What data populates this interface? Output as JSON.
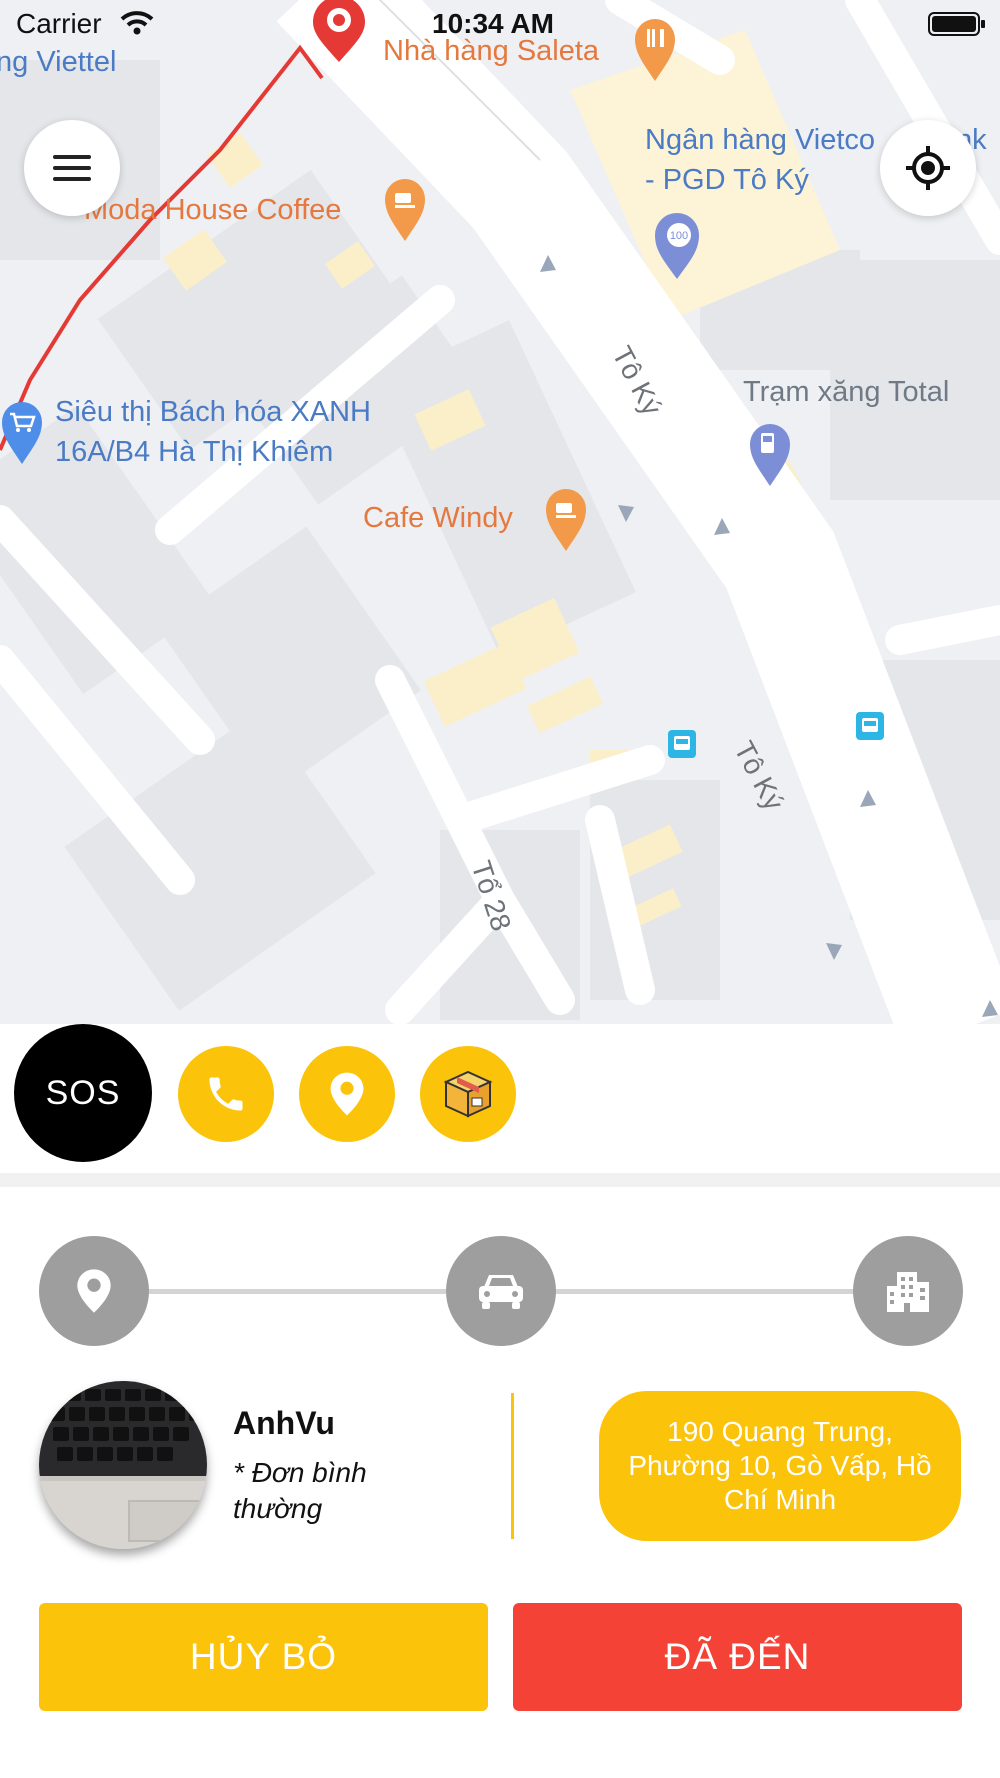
{
  "status_bar": {
    "carrier": "Carrier",
    "time": "10:34 AM"
  },
  "map": {
    "places": {
      "viettel": "ng Viettel",
      "saleta": "Nhà hàng Saleta",
      "vietcombank_line1": "Ngân hàng Vietco",
      "vietcombank_line1_end": "nk",
      "vietcombank_line2": "- PGD Tô Ký",
      "moda": "Moda House Coffee",
      "bach_hoa_line1": "Siêu thị Bách hóa XANH",
      "bach_hoa_line2": "16A/B4 Hà Thị Khiêm",
      "total": "Trạm xăng Total",
      "windy": "Cafe Windy"
    },
    "streets": {
      "to_ky_1": "Tô Ký",
      "to_ky_2": "Tô Ký",
      "to_28": "Tổ 28"
    },
    "bank_badge": "100"
  },
  "actions": {
    "sos": "SOS",
    "icons": [
      "phone-icon",
      "location-pin-icon",
      "package-icon"
    ]
  },
  "trip_progress": {
    "steps": [
      "pickup-pin-icon",
      "car-icon",
      "building-icon"
    ]
  },
  "driver": {
    "name": "AnhVu",
    "note": "* Đơn bình thường"
  },
  "destination": {
    "address": "190 Quang Trung, Phường 10, Gò Vấp, Hồ Chí Minh"
  },
  "buttons": {
    "cancel": "HỦY BỎ",
    "arrived": "ĐÃ ĐẾN"
  },
  "colors": {
    "accent_yellow": "#fcc30b",
    "danger_red": "#f44336",
    "route_red": "#e53935",
    "step_gray": "#9e9e9e"
  }
}
